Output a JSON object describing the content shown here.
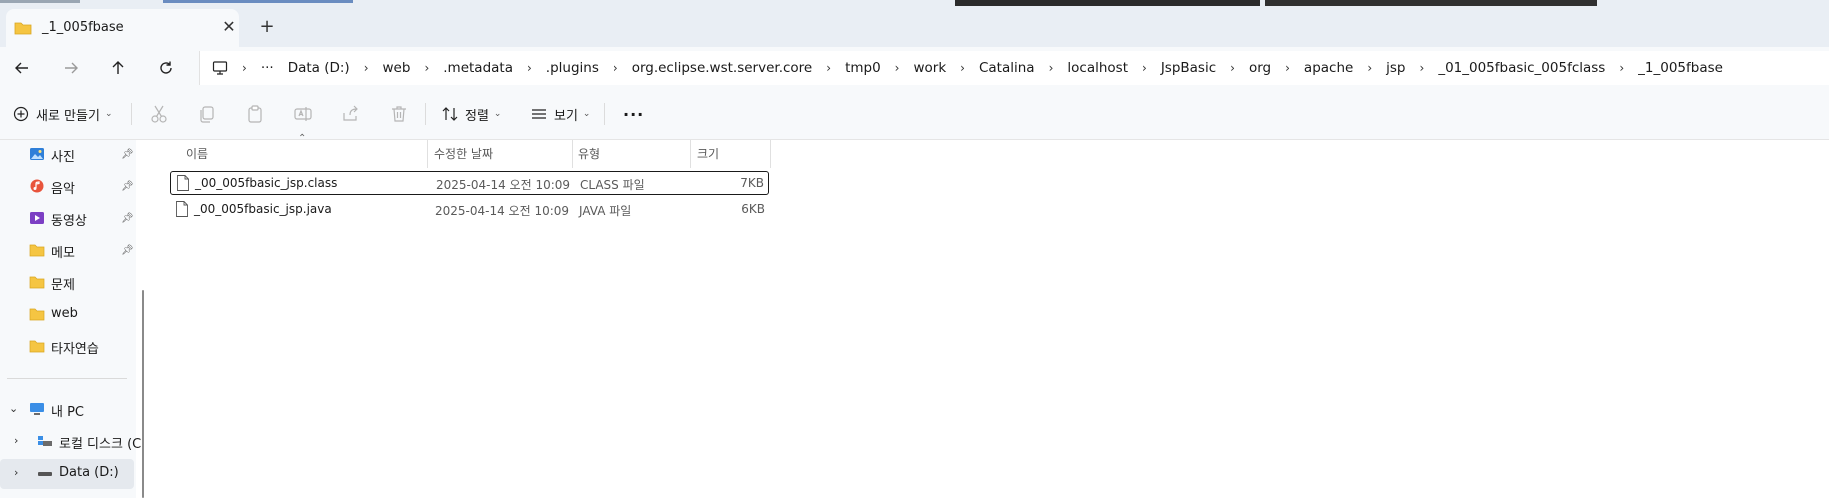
{
  "window": {
    "tab_title": "_1_005fbase",
    "close_glyph": "✕",
    "new_tab_glyph": "+"
  },
  "nav": {
    "back": "arrow-left-icon",
    "forward": "arrow-right-icon",
    "up": "arrow-up-icon",
    "refresh": "refresh-icon"
  },
  "breadcrumb": {
    "overflow": "···",
    "items": [
      "Data (D:)",
      "web",
      ".metadata",
      ".plugins",
      "org.eclipse.wst.server.core",
      "tmp0",
      "work",
      "Catalina",
      "localhost",
      "JspBasic",
      "org",
      "apache",
      "jsp",
      "_01_005fbasic_005fclass",
      "_1_005fbase"
    ]
  },
  "toolbar": {
    "new_label": "새로 만들기",
    "sort_label": "정렬",
    "view_label": "보기",
    "more_label": "···"
  },
  "sidebar": {
    "quick_access": [
      {
        "label": "사진",
        "icon": "pictures-icon",
        "pinned": true
      },
      {
        "label": "음악",
        "icon": "music-icon",
        "pinned": true
      },
      {
        "label": "동영상",
        "icon": "video-icon",
        "pinned": true
      },
      {
        "label": "메모",
        "icon": "folder-icon",
        "pinned": true
      },
      {
        "label": "문제",
        "icon": "folder-icon",
        "pinned": false
      },
      {
        "label": "web",
        "icon": "folder-icon",
        "pinned": false
      },
      {
        "label": "타자연습",
        "icon": "folder-icon",
        "pinned": false
      }
    ],
    "pc_label": "내 PC",
    "drives": [
      {
        "label": "로컬 디스크 (C",
        "icon": "local-disk-icon"
      },
      {
        "label": "Data (D:)",
        "icon": "drive-icon"
      }
    ]
  },
  "columns": {
    "name": "이름",
    "modified": "수정한 날짜",
    "type": "유형",
    "size": "크기"
  },
  "files": [
    {
      "name": "_00_005fbasic_jsp.class",
      "modified": "2025-04-14 오전 10:09",
      "type": "CLASS 파일",
      "size": "7KB",
      "selected": true
    },
    {
      "name": "_00_005fbasic_jsp.java",
      "modified": "2025-04-14 오전 10:09",
      "type": "JAVA 파일",
      "size": "6KB",
      "selected": false
    }
  ],
  "colors": {
    "accent": "#0067c0",
    "folder": "#f5c542"
  }
}
